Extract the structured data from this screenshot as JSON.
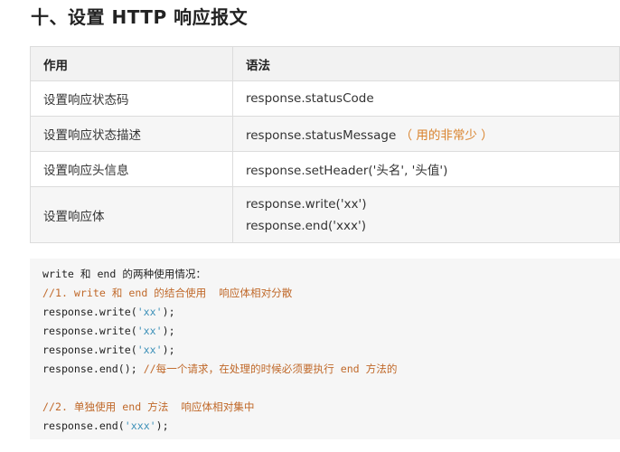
{
  "heading": "十、设置 HTTP 响应报文",
  "table": {
    "headers": [
      "作用",
      "语法"
    ],
    "rows": [
      {
        "purpose": "设置响应状态码",
        "syntax": "response.statusCode"
      },
      {
        "purpose": "设置响应状态描述",
        "syntax": "response.statusMessage",
        "note": "（ 用的非常少 ）"
      },
      {
        "purpose": "设置响应头信息",
        "syntax": "response.setHeader('头名', '头值')"
      },
      {
        "purpose": "设置响应体",
        "syntax": "response.write('xx')",
        "syntax2": "response.end('xxx')"
      }
    ]
  },
  "code": {
    "intro": "write 和 end 的两种使用情况：",
    "comment1": "//1. write 和 end 的结合使用  响应体相对分散",
    "write_prefix": "response.write(",
    "write_arg": "'xx'",
    "close": ");",
    "end_empty": "response.end(); ",
    "comment_end": "//每一个请求，在处理的时候必须要执行 end 方法的",
    "comment2": "//2. 单独使用 end 方法  响应体相对集中",
    "end_prefix": "response.end(",
    "end_arg": "'xxx'"
  }
}
